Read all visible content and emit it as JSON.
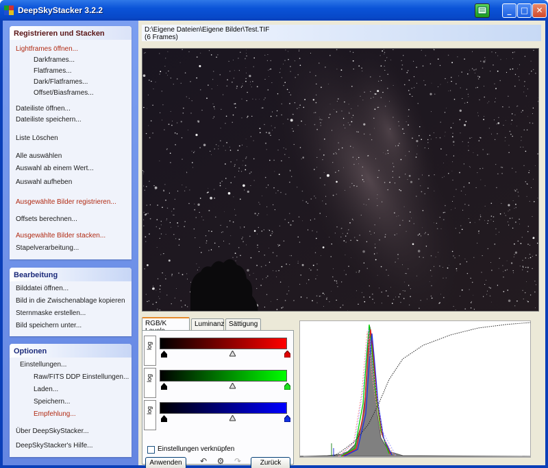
{
  "window": {
    "title": "DeepSkyStacker 3.2.2"
  },
  "title_buttons": {
    "minimize": "_",
    "maximize": "□",
    "close": "✕"
  },
  "sidebar": {
    "panel1": {
      "title": "Registrieren und Stacken",
      "items": [
        "Lightframes öffnen...",
        "Darkframes...",
        "Flatframes...",
        "Dark/Flatframes...",
        "Offset/Biasframes...",
        "Dateiliste öffnen...",
        "Dateiliste speichern...",
        "Liste Löschen",
        "Alle auswählen",
        "Auswahl ab einem Wert...",
        "Auswahl aufheben",
        "Ausgewählte Bilder registrieren...",
        "Offsets berechnen...",
        "Ausgewählte Bilder stacken...",
        "Stapelverarbeitung..."
      ]
    },
    "panel2": {
      "title": "Bearbeitung",
      "items": [
        "Bilddatei öffnen...",
        "Bild in die Zwischenablage kopieren",
        "Sternmaske erstellen...",
        "Bild speichern unter..."
      ]
    },
    "panel3": {
      "title": "Optionen",
      "items": [
        "Einstellungen...",
        "Raw/FITS DDP Einstellungen...",
        "Laden...",
        "Speichern...",
        "Empfehlung...",
        "Über DeepSkyStacker...",
        "DeepSkyStacker's Hilfe..."
      ]
    }
  },
  "file": {
    "path": "D:\\Eigene Dateien\\Eigene Bilder\\Test.TIF",
    "frames": "(6 Frames)"
  },
  "tabs": [
    "RGB/K Levels",
    "Luminanz",
    "Sättigung"
  ],
  "levels": {
    "log_label": "log",
    "link_label": "Einstellungen verknüpfen",
    "apply": "Anwenden",
    "reset": "Zurück"
  },
  "colors": {
    "red": "#ff0000",
    "green": "#00ff00",
    "blue": "#0000ff",
    "accent_red": "#b12a12"
  }
}
